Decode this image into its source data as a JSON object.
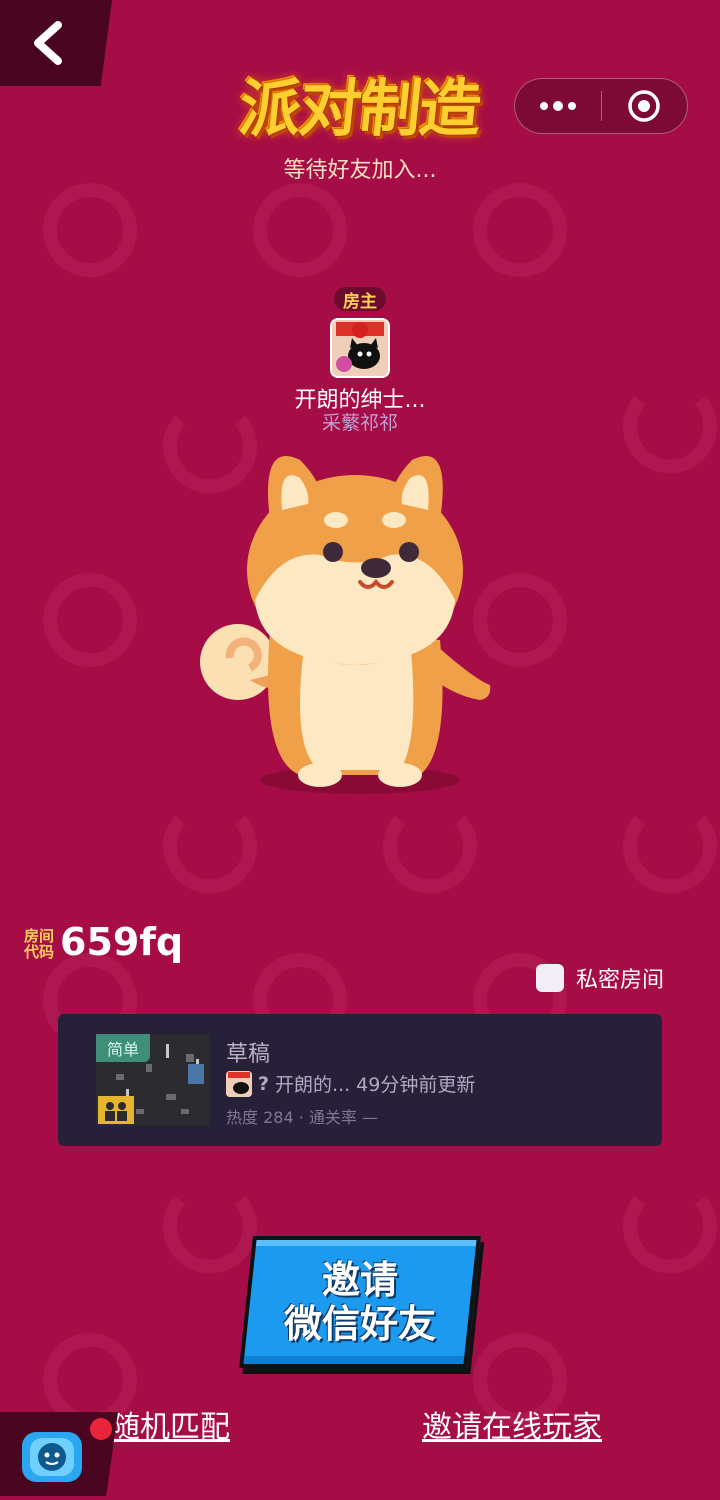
{
  "header": {
    "game_logo_text": "派对制造",
    "status_text": "等待好友加入...",
    "back_icon": "chevron-left-icon",
    "capsule": {
      "more_icon": "more-dots-icon",
      "close_icon": "target-circle-icon"
    }
  },
  "host": {
    "badge": "房主",
    "name": "开朗的绅士...",
    "subname": "采蘩祁祁"
  },
  "room": {
    "code_label": "房间代码",
    "code": "659fq",
    "private_label": "私密房间"
  },
  "level": {
    "difficulty": "简单",
    "title": "草稿",
    "author_prefix": "?",
    "author_name": "开朗的...",
    "updated": "49分钟前更新",
    "stats": "热度 284 · 通关率 —"
  },
  "actions": {
    "invite_wechat": "邀请\n微信好友",
    "random_match": "随机匹配",
    "invite_online": "邀请在线玩家"
  },
  "colors": {
    "background": "#a60c45",
    "accent_blue": "#1b9af0",
    "card_bg": "#262038",
    "gold": "#ffd05a"
  }
}
